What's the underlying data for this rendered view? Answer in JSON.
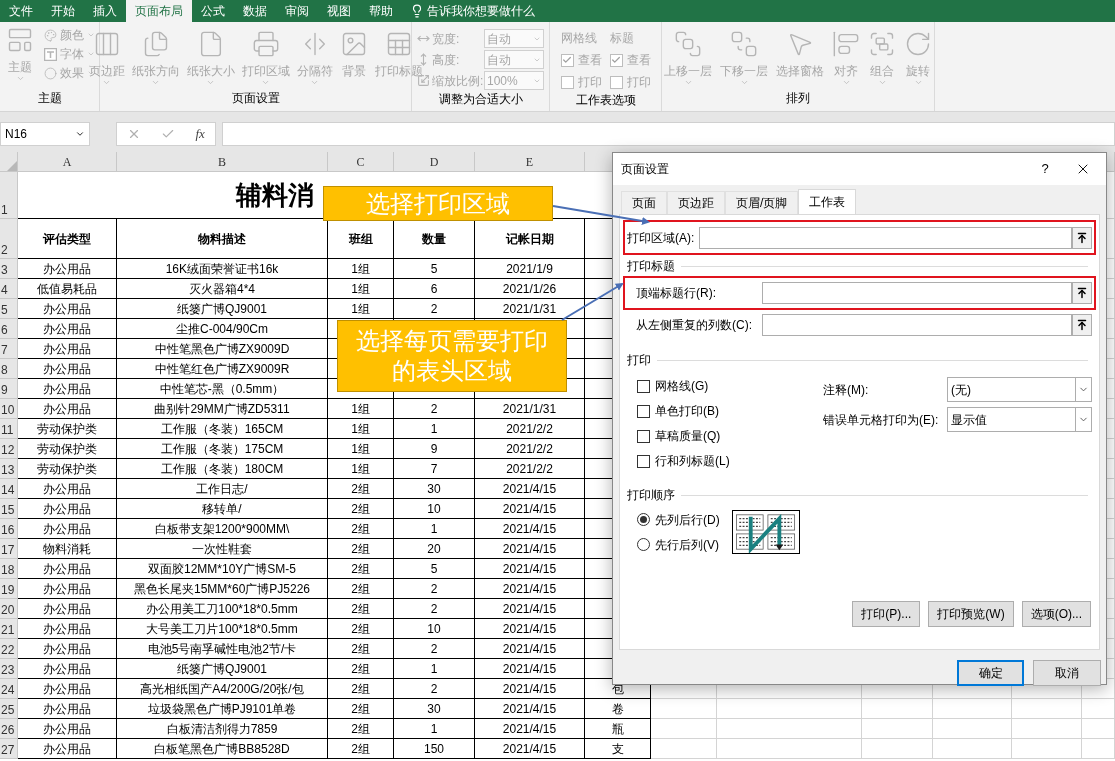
{
  "tabs": [
    {
      "label": "文件",
      "selected": false
    },
    {
      "label": "开始",
      "selected": false
    },
    {
      "label": "插入",
      "selected": false
    },
    {
      "label": "页面布局",
      "selected": true
    },
    {
      "label": "公式",
      "selected": false
    },
    {
      "label": "数据",
      "selected": false
    },
    {
      "label": "审阅",
      "selected": false
    },
    {
      "label": "视图",
      "selected": false
    },
    {
      "label": "帮助",
      "selected": false
    }
  ],
  "tell_me": "告诉我你想要做什么",
  "ribbon": {
    "disabled": true,
    "theme_group": {
      "label": "主题",
      "main": "主题",
      "options": [
        "颜色",
        "字体",
        "效果"
      ]
    },
    "page_setup_group": {
      "label": "页面设置",
      "buttons": [
        "页边距",
        "纸张方向",
        "纸张大小",
        "打印区域",
        "分隔符",
        "背景",
        "打印标题"
      ]
    },
    "scale_group": {
      "label": "调整为合适大小",
      "fields": [
        {
          "label": "宽度:",
          "value": "自动"
        },
        {
          "label": "高度:",
          "value": "自动"
        },
        {
          "label": "缩放比例:",
          "value": "100%"
        }
      ]
    },
    "sheet_options_group": {
      "label": "工作表选项",
      "sections": [
        {
          "title": "网格线",
          "options": [
            {
              "label": "查看",
              "checked": true
            },
            {
              "label": "打印",
              "checked": false
            }
          ]
        },
        {
          "title": "标题",
          "options": [
            {
              "label": "查看",
              "checked": true
            },
            {
              "label": "打印",
              "checked": false
            }
          ]
        }
      ]
    },
    "arrange_group": {
      "label": "排列",
      "buttons": [
        "上移一层",
        "下移一层",
        "选择窗格",
        "对齐",
        "组合",
        "旋转"
      ]
    }
  },
  "formula_bar": {
    "name_box": "N16",
    "fx": "fx"
  },
  "sheet": {
    "columns": [
      "A",
      "B",
      "C",
      "D",
      "E"
    ],
    "title": "辅料消",
    "title_row": "1",
    "header_row": "2",
    "headers": [
      "评估类型",
      "物料描述",
      "班组",
      "数量",
      "记帐日期"
    ],
    "rows": [
      {
        "n": "3",
        "cells": [
          "办公用品",
          "16K绒面荣誉证书16k",
          "1组",
          "5",
          "2021/1/9",
          null
        ]
      },
      {
        "n": "4",
        "cells": [
          "低值易耗品",
          "灭火器箱4*4",
          "1组",
          "6",
          "2021/1/26",
          null
        ]
      },
      {
        "n": "5",
        "cells": [
          "办公用品",
          "纸篓广博QJ9001",
          "1组",
          "2",
          "2021/1/31",
          null
        ]
      },
      {
        "n": "6",
        "cells": [
          "办公用品",
          "尘推C-004/90Cm",
          null,
          null,
          null,
          null
        ]
      },
      {
        "n": "7",
        "cells": [
          "办公用品",
          "中性笔黑色广博ZX9009D",
          null,
          null,
          null,
          null
        ]
      },
      {
        "n": "8",
        "cells": [
          "办公用品",
          "中性笔红色广博ZX9009R",
          null,
          null,
          null,
          null
        ]
      },
      {
        "n": "9",
        "cells": [
          "办公用品",
          "中性笔芯-黑（0.5mm）",
          null,
          null,
          null,
          null
        ]
      },
      {
        "n": "10",
        "cells": [
          "办公用品",
          "曲别针29MM广博ZD5311",
          "1组",
          "2",
          "2021/1/31",
          null
        ]
      },
      {
        "n": "11",
        "cells": [
          "劳动保护类",
          "工作服（冬装）165CM",
          "1组",
          "1",
          "2021/2/2",
          null
        ]
      },
      {
        "n": "12",
        "cells": [
          "劳动保护类",
          "工作服（冬装）175CM",
          "1组",
          "9",
          "2021/2/2",
          null
        ]
      },
      {
        "n": "13",
        "cells": [
          "劳动保护类",
          "工作服（冬装）180CM",
          "1组",
          "7",
          "2021/2/2",
          null
        ]
      },
      {
        "n": "14",
        "cells": [
          "办公用品",
          "工作日志/",
          "2组",
          "30",
          "2021/4/15",
          null
        ]
      },
      {
        "n": "15",
        "cells": [
          "办公用品",
          "移转单/",
          "2组",
          "10",
          "2021/4/15",
          null
        ]
      },
      {
        "n": "16",
        "cells": [
          "办公用品",
          "白板带支架1200*900MM\\",
          "2组",
          "1",
          "2021/4/15",
          null
        ]
      },
      {
        "n": "17",
        "cells": [
          "物料消耗",
          "一次性鞋套",
          "2组",
          "20",
          "2021/4/15",
          null
        ]
      },
      {
        "n": "18",
        "cells": [
          "办公用品",
          "双面胶12MM*10Y广博SM-5",
          "2组",
          "5",
          "2021/4/15",
          null
        ]
      },
      {
        "n": "19",
        "cells": [
          "办公用品",
          "黑色长尾夹15MM*60广博PJ5226",
          "2组",
          "2",
          "2021/4/15",
          null
        ]
      },
      {
        "n": "20",
        "cells": [
          "办公用品",
          "办公用美工刀100*18*0.5mm",
          "2组",
          "2",
          "2021/4/15",
          null
        ]
      },
      {
        "n": "21",
        "cells": [
          "办公用品",
          "大号美工刀片100*18*0.5mm",
          "2组",
          "10",
          "2021/4/15",
          null
        ]
      },
      {
        "n": "22",
        "cells": [
          "办公用品",
          "电池5号南孚碱性电池2节/卡",
          "2组",
          "2",
          "2021/4/15",
          null
        ]
      },
      {
        "n": "23",
        "cells": [
          "办公用品",
          "纸篓广博QJ9001",
          "2组",
          "1",
          "2021/4/15",
          null
        ]
      },
      {
        "n": "24",
        "cells": [
          "办公用品",
          "高光相纸国产A4/200G/20张/包",
          "2组",
          "2",
          "2021/4/15",
          "包"
        ]
      },
      {
        "n": "25",
        "cells": [
          "办公用品",
          "垃圾袋黑色广博PJ9101单卷",
          "2组",
          "30",
          "2021/4/15",
          "卷"
        ]
      },
      {
        "n": "26",
        "cells": [
          "办公用品",
          "白板清洁剂得力7859",
          "2组",
          "1",
          "2021/4/15",
          "瓶"
        ]
      },
      {
        "n": "27",
        "cells": [
          "办公用品",
          "白板笔黑色广博BB8528D",
          "2组",
          "150",
          "2021/4/15",
          "支"
        ]
      }
    ]
  },
  "dialog": {
    "title": "页面设置",
    "help": "?",
    "tabs": [
      {
        "label": "页面",
        "selected": false
      },
      {
        "label": "页边距",
        "selected": false
      },
      {
        "label": "页眉/页脚",
        "selected": false
      },
      {
        "label": "工作表",
        "selected": true
      }
    ],
    "print_area": {
      "label": "打印区域(A):"
    },
    "print_titles": {
      "title": "打印标题",
      "fields": [
        {
          "label": "顶端标题行(R):"
        },
        {
          "label": "从左侧重复的列数(C):"
        }
      ]
    },
    "print": {
      "title": "打印",
      "checkboxes": [
        {
          "label": "网格线(G)",
          "checked": false
        },
        {
          "label": "单色打印(B)",
          "checked": false
        },
        {
          "label": "草稿质量(Q)",
          "checked": false
        },
        {
          "label": "行和列标题(L)",
          "checked": false
        }
      ],
      "selects": [
        {
          "label": "注释(M):",
          "value": "(无)"
        },
        {
          "label": "错误单元格打印为(E):",
          "value": "显示值"
        }
      ]
    },
    "print_order": {
      "title": "打印顺序",
      "options": [
        {
          "label": "先列后行(D)",
          "selected": true
        },
        {
          "label": "先行后列(V)",
          "selected": false
        }
      ]
    },
    "buttons": [
      "打印(P)...",
      "打印预览(W)",
      "选项(O)..."
    ],
    "ok": "确定",
    "cancel": "取消"
  },
  "callouts": [
    {
      "text": "选择打印区域"
    },
    {
      "text": "选择每页需要打印的表头区域"
    }
  ]
}
